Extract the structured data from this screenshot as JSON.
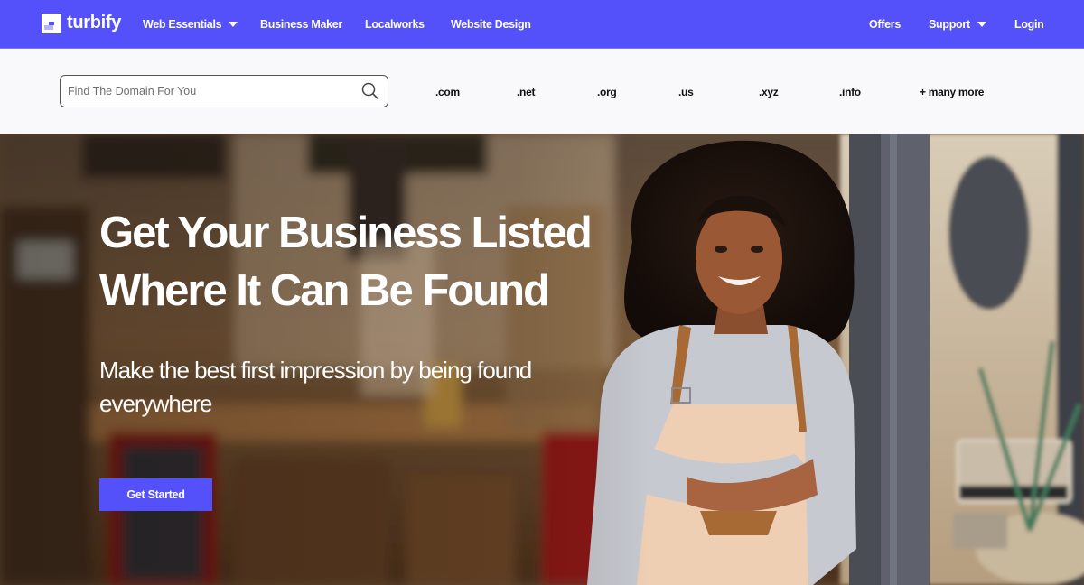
{
  "brand": {
    "name": "turbify",
    "primary_color": "#5451fb",
    "text_on_primary": "#ffffff"
  },
  "nav": {
    "left": [
      {
        "label": "Web Essentials",
        "has_dropdown": true
      },
      {
        "label": "Business Maker",
        "has_dropdown": false
      },
      {
        "label": "Localworks",
        "has_dropdown": false
      },
      {
        "label": "Website Design",
        "has_dropdown": false
      }
    ],
    "right": [
      {
        "label": "Offers",
        "has_dropdown": false
      },
      {
        "label": "Support",
        "has_dropdown": true
      },
      {
        "label": "Login",
        "has_dropdown": false
      }
    ]
  },
  "domain_search": {
    "placeholder": "Find The Domain For You",
    "value": "",
    "icon": "search-icon",
    "tlds": [
      ".com",
      ".net",
      ".org",
      ".us",
      ".xyz",
      ".info",
      "+ many more"
    ]
  },
  "hero": {
    "title_line1": "Get Your Business Listed",
    "title_line2": "Where It Can Be Found",
    "subtitle_line1": "Make the best first impression by being found",
    "subtitle_line2": "everywhere",
    "cta_label": "Get Started",
    "image_description": "Smiling woman with curly hair wearing an apron, arms crossed, leaning on a shop doorway; blurred cafe interior behind"
  }
}
